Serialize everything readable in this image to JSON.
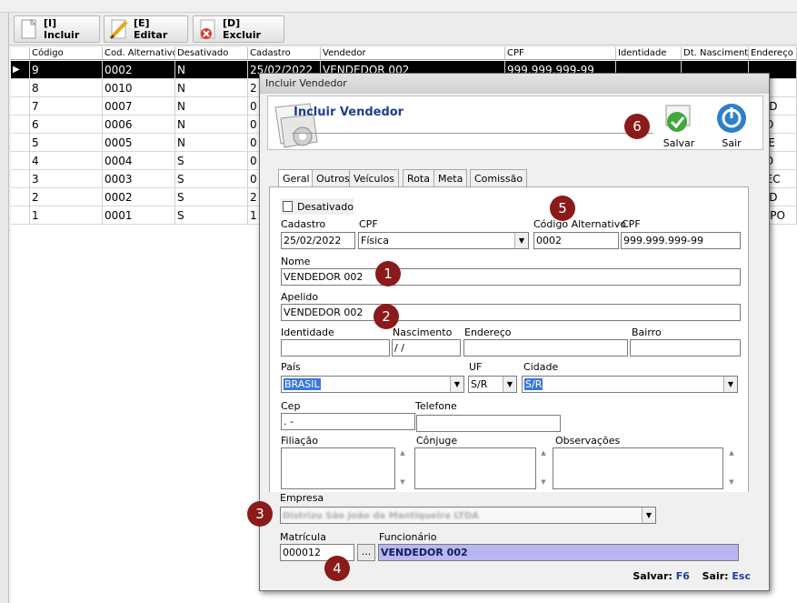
{
  "toolbar": {
    "incluir": "[I] Incluir",
    "editar": "[E] Editar",
    "excluir": "[D] Excluir"
  },
  "grid": {
    "columns": [
      "Código",
      "Cod. Alternativo",
      "Desativado",
      "Cadastro",
      "Vendedor",
      "CPF",
      "Identidade",
      "Dt. Nascimento",
      "Endereço"
    ],
    "rows": [
      {
        "codigo": "9",
        "alt": "0002",
        "desat": "N",
        "cad": "25/02/2022",
        "vend": "VENDEDOR 002",
        "cpf": "999.999.999-99",
        "end": ""
      },
      {
        "codigo": "8",
        "alt": "0010",
        "desat": "N",
        "cad": "2",
        "vend": "",
        "cpf": "",
        "end": ""
      },
      {
        "codigo": "7",
        "alt": "0007",
        "desat": "N",
        "cad": "0",
        "vend": "",
        "cpf": "",
        "end": "A AD"
      },
      {
        "codigo": "6",
        "alt": "0006",
        "desat": "N",
        "cad": "0",
        "vend": "",
        "cpf": "",
        "end": "SÃO"
      },
      {
        "codigo": "5",
        "alt": "0005",
        "desat": "N",
        "cad": "0",
        "vend": "",
        "cpf": "",
        "end": "A PE"
      },
      {
        "codigo": "4",
        "alt": "0004",
        "desat": "S",
        "cad": "0",
        "vend": "",
        "cpf": "",
        "end": "A JO"
      },
      {
        "codigo": "3",
        "alt": "0003",
        "desat": "S",
        "cad": "0",
        "vend": "",
        "cpf": "",
        "end": "RREC"
      },
      {
        "codigo": "2",
        "alt": "0002",
        "desat": "S",
        "cad": "2",
        "vend": "",
        "cpf": "",
        "end": "A AD"
      },
      {
        "codigo": "1",
        "alt": "0001",
        "desat": "S",
        "cad": "1",
        "vend": "",
        "cpf": "",
        "end": "AO PO"
      }
    ]
  },
  "dialog": {
    "title": "Incluir Vendedor",
    "header": "Incluir Vendedor",
    "salvar": "Salvar",
    "sair": "Sair",
    "tabs": [
      "Geral",
      "Outros",
      "Veículos",
      "Rota",
      "Meta",
      "Comissão"
    ],
    "desativado": "Desativado",
    "lbl_cadastro": "Cadastro",
    "cadastro": "25/02/2022",
    "lbl_cpf_tipo": "CPF",
    "cpf_tipo": "Física",
    "lbl_cod_alt": "Código Alternativo",
    "cod_alt": "0002",
    "lbl_cpf": "CPF",
    "cpf": "999.999.999-99",
    "lbl_nome": "Nome",
    "nome": "VENDEDOR 002",
    "lbl_apelido": "Apelido",
    "apelido": "VENDEDOR 002",
    "lbl_identidade": "Identidade",
    "identidade": "",
    "lbl_nascimento": "Nascimento",
    "nascimento": " / /",
    "lbl_endereco": "Endereço",
    "endereco": "",
    "lbl_bairro": "Bairro",
    "bairro": "",
    "lbl_pais": "País",
    "pais": "BRASIL",
    "lbl_uf": "UF",
    "uf": "S/R",
    "lbl_cidade": "Cidade",
    "cidade": "S/R",
    "lbl_cep": "Cep",
    "cep": " .  -",
    "lbl_telefone": "Telefone",
    "telefone": "",
    "lbl_filiacao": "Filiação",
    "lbl_conjuge": "Cônjuge",
    "lbl_obs": "Observações",
    "lbl_empresa": "Empresa",
    "empresa": "Distrizu São João da Mantiqueira LTDA",
    "lbl_matricula": "Matrícula",
    "matricula": "000012",
    "ellipsis": "...",
    "lbl_funcionario": "Funcionário",
    "funcionario": "VENDEDOR 002",
    "status_salvar_lbl": "Salvar:",
    "status_salvar_key": "F6",
    "status_sair_lbl": "Sair:",
    "status_sair_key": "Esc"
  },
  "badges": [
    "1",
    "2",
    "3",
    "4",
    "5",
    "6"
  ],
  "colors": {
    "badge": "#8b1a1a",
    "func_bg": "#b9b6f2",
    "sel_row": "#000000",
    "highlight": "#3a78d8"
  }
}
